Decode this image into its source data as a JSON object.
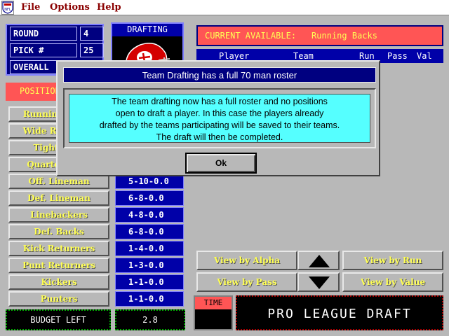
{
  "menu": {
    "items": [
      "File",
      "Options",
      "Help"
    ]
  },
  "info": {
    "round_label": "ROUND",
    "round_value": "4",
    "pick_label": "PICK #",
    "pick_value": "25",
    "overall_label": "OVERALL"
  },
  "drafting": {
    "title": "DRAFTING"
  },
  "available": {
    "label": "CURRENT AVAILABLE:",
    "position": "Running Backs",
    "columns": [
      "Player",
      "Team",
      "Run",
      "Pass",
      "Val"
    ]
  },
  "positions": {
    "header": "POSITIONS",
    "rows": [
      {
        "label": "Running Backs",
        "value": ""
      },
      {
        "label": "Wide Receivers",
        "value": ""
      },
      {
        "label": "Tight Ends",
        "value": ""
      },
      {
        "label": "Quarterbacks",
        "value": ""
      },
      {
        "label": "Off. Lineman",
        "value": "5-10-0.0"
      },
      {
        "label": "Def. Lineman",
        "value": "6-8-0.0"
      },
      {
        "label": "Linebackers",
        "value": "4-8-0.0"
      },
      {
        "label": "Def. Backs",
        "value": "6-8-0.0"
      },
      {
        "label": "Kick Returners",
        "value": "1-4-0.0"
      },
      {
        "label": "Punt Returners",
        "value": "1-3-0.0"
      },
      {
        "label": "Kickers",
        "value": "1-1-0.0"
      },
      {
        "label": "Punters",
        "value": "1-1-0.0"
      }
    ]
  },
  "budget": {
    "label": "BUDGET LEFT",
    "value": "2.8"
  },
  "views": {
    "alpha": "View by Alpha",
    "run": "View by Run",
    "pass": "View by Pass",
    "value": "View by Value"
  },
  "time": {
    "label": "TIME"
  },
  "title_banner": "PRO LEAGUE DRAFT",
  "dialog": {
    "title": "Team Drafting has a full 70 man roster",
    "lines": [
      "The team drafting now has a full roster and no positions",
      "open to draft a player. In this case the players already",
      "drafted by the teams participating will be saved to their teams.",
      "The draft will then be completed."
    ],
    "ok_label": "Ok"
  },
  "colors": {
    "dialog_title_bg": "#000080",
    "dialog_msg_bg": "#55ffff",
    "accent_red": "#ff5555",
    "label_yellow": "#ffff55"
  }
}
